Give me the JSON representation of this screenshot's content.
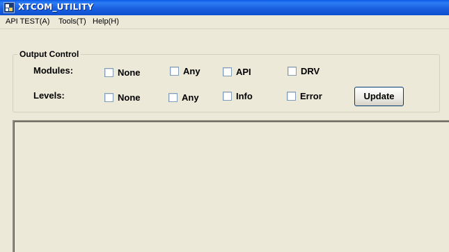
{
  "window": {
    "title": "XTCOM_UTILITY",
    "icon": "app-icon"
  },
  "menu": [
    {
      "label": "API TEST(A)"
    },
    {
      "label": "Tools(T)"
    },
    {
      "label": "Help(H)"
    }
  ],
  "output_control": {
    "title": "Output Control",
    "modules": {
      "label": "Modules:",
      "options": [
        {
          "label": "None",
          "checked": false
        },
        {
          "label": "Any",
          "checked": false
        },
        {
          "label": "API",
          "checked": false
        },
        {
          "label": "DRV",
          "checked": false
        }
      ]
    },
    "levels": {
      "label": "Levels:",
      "options": [
        {
          "label": "None",
          "checked": false
        },
        {
          "label": "Any",
          "checked": false
        },
        {
          "label": "Info",
          "checked": false
        },
        {
          "label": "Error",
          "checked": false
        }
      ]
    },
    "update_label": "Update"
  }
}
